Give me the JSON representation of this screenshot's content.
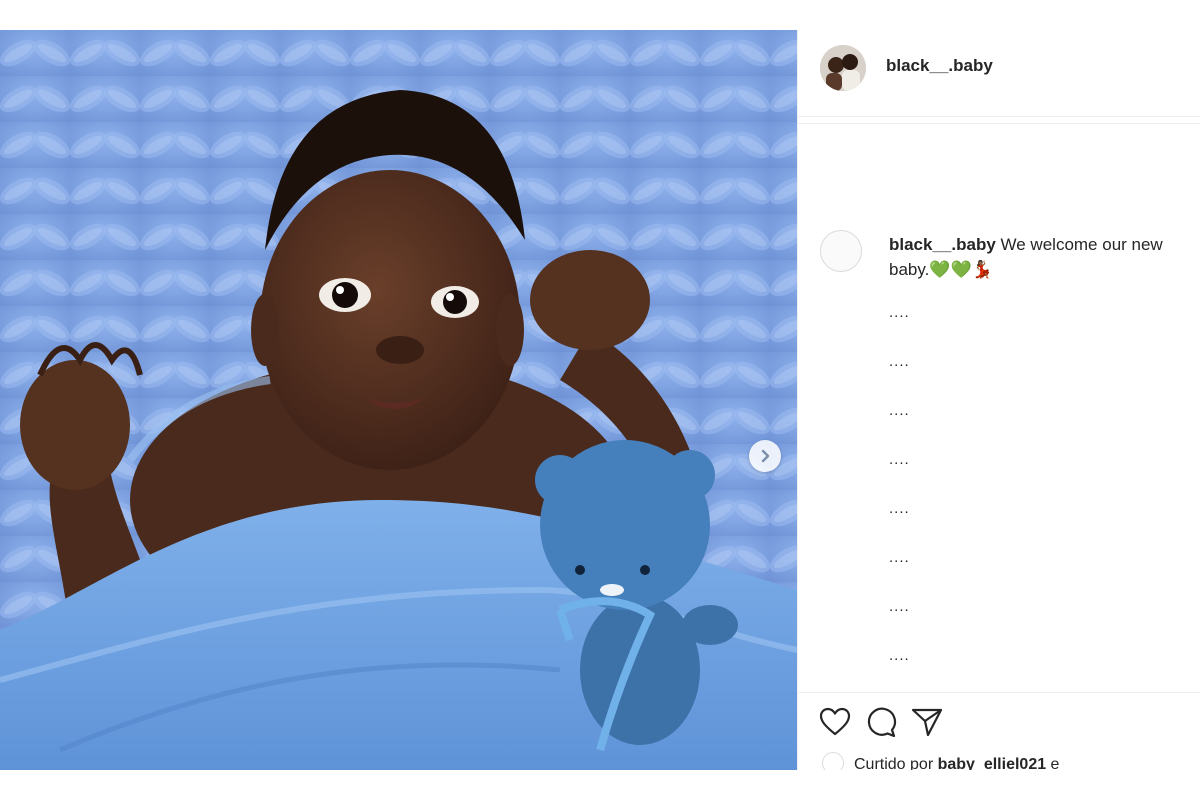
{
  "post": {
    "username": "black__.baby",
    "caption_text": "We welcome our new baby.💚💚💃🏾",
    "comment_placeholders": [
      "....",
      "....",
      "....",
      "....",
      "....",
      "....",
      "....",
      "...."
    ],
    "liked_by_prefix": "Curtido por ",
    "liked_by_user": "baby_elliel021",
    "liked_by_suffix": " e"
  },
  "icons": {
    "next": "chevron-right-icon",
    "like": "heart-icon",
    "comment": "comment-bubble-icon",
    "share": "paper-plane-icon"
  },
  "colors": {
    "blanket": "#7da2e0",
    "text": "#262626",
    "border": "#efefef"
  }
}
